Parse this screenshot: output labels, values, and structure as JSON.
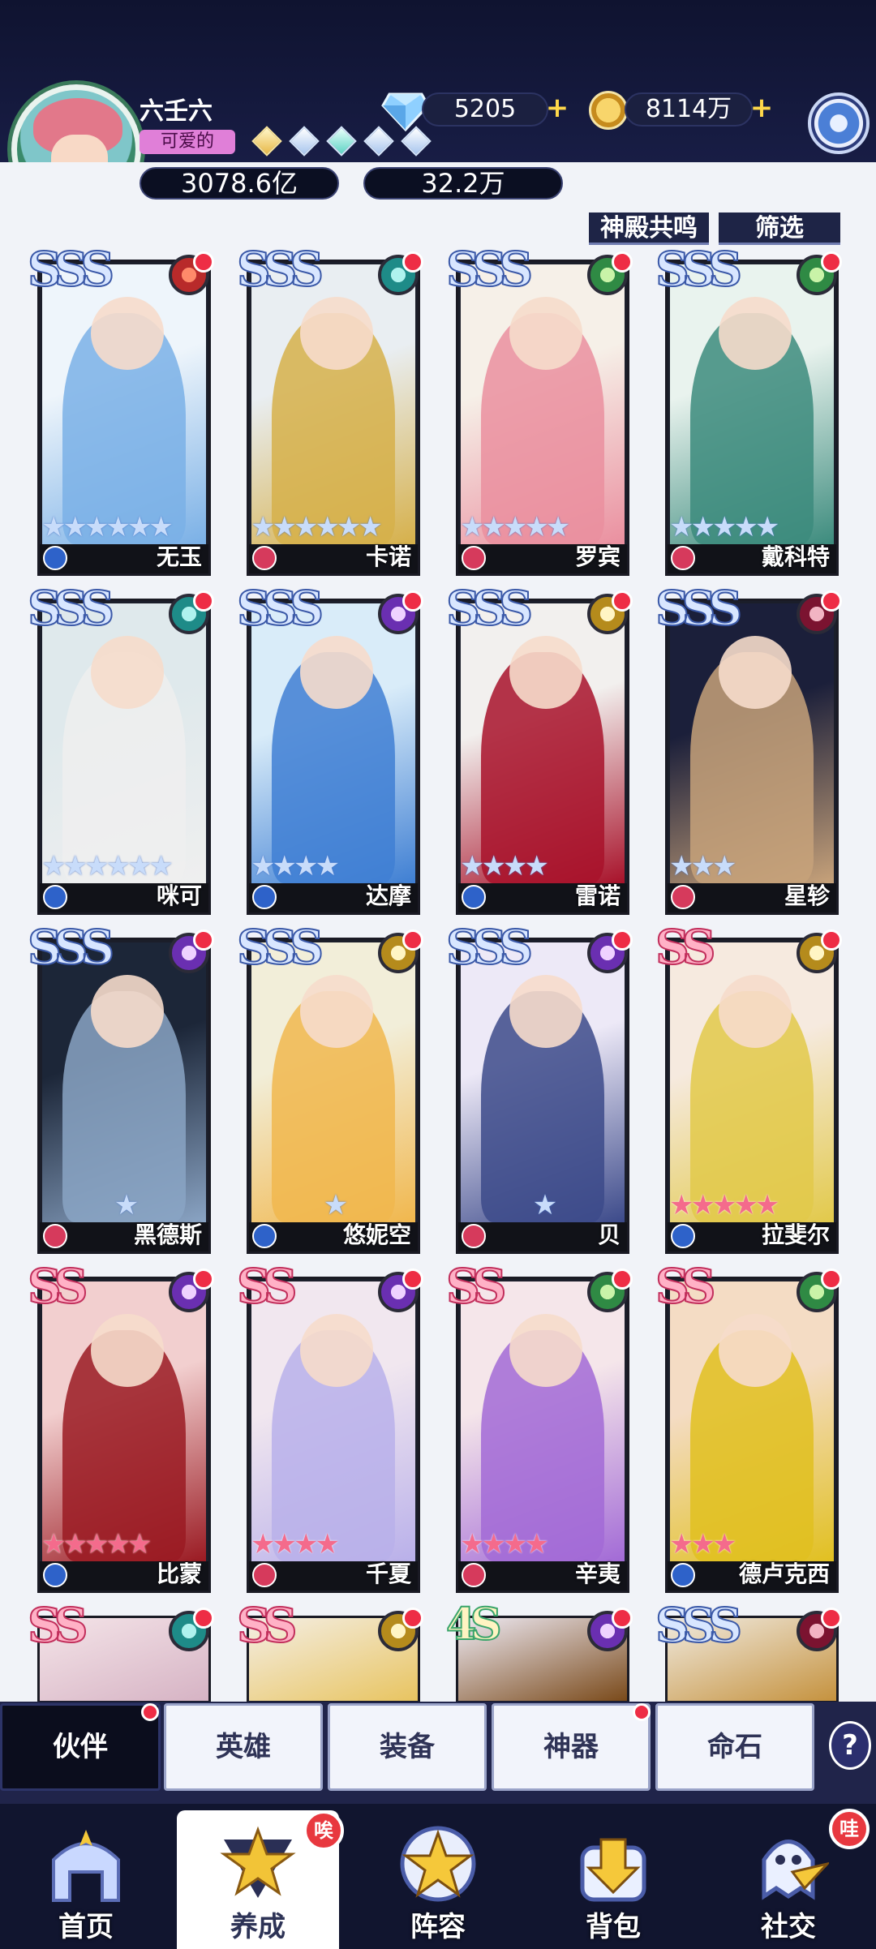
{
  "player": {
    "name": "六壬六",
    "title": "可爱的",
    "power": "3078.6亿",
    "stars": "32.2万"
  },
  "resources": {
    "diamonds": "5205",
    "gold": "8114万"
  },
  "top_buttons": {
    "resonance": "神殿共鸣",
    "filter": "筛选"
  },
  "cards": [
    {
      "name": "无玉",
      "rarity": "SSS",
      "element": "fire",
      "stars": "★★★★★★",
      "palette": [
        "#eef5fb",
        "#7ab0e6"
      ],
      "class": "blue"
    },
    {
      "name": "卡诺",
      "rarity": "SSS",
      "element": "wind",
      "stars": "★★★★★★",
      "palette": [
        "#e9eef2",
        "#d6b04a"
      ],
      "class": "red"
    },
    {
      "name": "罗宾",
      "rarity": "SSS",
      "element": "leaf",
      "stars": "★★★★★",
      "palette": [
        "#f6f0e8",
        "#ea8f9f"
      ],
      "class": "red"
    },
    {
      "name": "戴科特",
      "rarity": "SSS",
      "element": "leaf",
      "stars": "★★★★★",
      "palette": [
        "#e9f3ee",
        "#3c8b7d"
      ],
      "class": "red"
    },
    {
      "name": "咪可",
      "rarity": "SSS",
      "element": "wind",
      "stars": "★★★★★★",
      "palette": [
        "#dfe9ec",
        "#efefef"
      ],
      "class": "blue"
    },
    {
      "name": "达摩",
      "rarity": "SSS",
      "element": "moon",
      "stars": "★★★★",
      "palette": [
        "#d9ecf9",
        "#3f7fd3"
      ],
      "class": "blue"
    },
    {
      "name": "雷诺",
      "rarity": "SSS",
      "element": "light",
      "stars": "★★★★",
      "palette": [
        "#f2f0ee",
        "#a8122a"
      ],
      "class": "blue"
    },
    {
      "name": "星轸",
      "rarity": "SSS",
      "element": "dark",
      "stars": "★★★",
      "palette": [
        "#1b1f3a",
        "#c7a27a"
      ],
      "class": "red"
    },
    {
      "name": "黑德斯",
      "rarity": "SSS",
      "element": "moon",
      "stars": "★",
      "palette": [
        "#1c2638",
        "#8aa4c4"
      ],
      "class": "red"
    },
    {
      "name": "悠妮空",
      "rarity": "SSS",
      "element": "light",
      "stars": "★",
      "palette": [
        "#f2eed9",
        "#f1b74d"
      ],
      "class": "blue"
    },
    {
      "name": "贝",
      "rarity": "SSS",
      "element": "moon",
      "stars": "★",
      "palette": [
        "#ede9f7",
        "#3c4a8a"
      ],
      "class": "red"
    },
    {
      "name": "拉斐尔",
      "rarity": "SS",
      "element": "light",
      "stars": "★★★★★",
      "palette": [
        "#f6eadf",
        "#e2c94a"
      ],
      "class": "blue"
    },
    {
      "name": "比蒙",
      "rarity": "SS",
      "element": "moon",
      "stars": "★★★★★",
      "palette": [
        "#f2cfcf",
        "#9a1a22"
      ],
      "class": "blue"
    },
    {
      "name": "千夏",
      "rarity": "SS",
      "element": "moon",
      "stars": "★★★★",
      "palette": [
        "#f1e7ef",
        "#b9b0ea"
      ],
      "class": "red"
    },
    {
      "name": "辛夷",
      "rarity": "SS",
      "element": "leaf",
      "stars": "★★★★",
      "palette": [
        "#f5e6ea",
        "#a26ad6"
      ],
      "class": "red"
    },
    {
      "name": "德卢克西",
      "rarity": "SS",
      "element": "leaf",
      "stars": "★★★",
      "palette": [
        "#f4dcc4",
        "#e1c020"
      ],
      "class": "blue"
    }
  ],
  "partial_cards": [
    {
      "rarity": "SS",
      "element": "wind"
    },
    {
      "rarity": "SS",
      "element": "light"
    },
    {
      "rarity": "4S",
      "element": "moon"
    },
    {
      "rarity": "SSS",
      "element": "dark"
    }
  ],
  "tabs": [
    {
      "label": "伙伴",
      "active": true
    },
    {
      "label": "英雄"
    },
    {
      "label": "装备"
    },
    {
      "label": "神器"
    },
    {
      "label": "命石"
    }
  ],
  "help_label": "?",
  "bottom_nav": [
    {
      "label": "首页",
      "icon": "home-gate-icon"
    },
    {
      "label": "养成",
      "icon": "growth-star-icon",
      "active": true,
      "badge": "唉"
    },
    {
      "label": "阵容",
      "icon": "formation-star-icon"
    },
    {
      "label": "背包",
      "icon": "backpack-icon"
    },
    {
      "label": "社交",
      "icon": "social-ghost-icon",
      "badge": "哇"
    }
  ],
  "colors": {
    "header_bg": "#151a3d",
    "accent_gold": "#ffd84a",
    "badge_red": "#ee2d45"
  }
}
